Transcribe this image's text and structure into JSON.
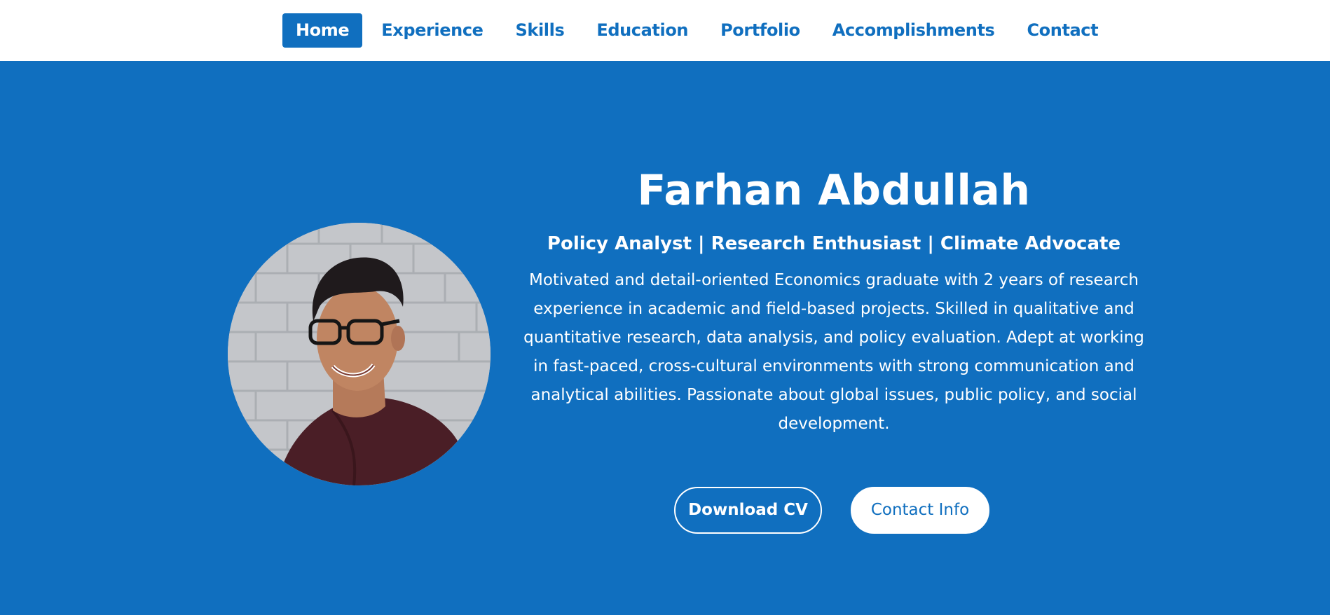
{
  "nav": {
    "items": [
      {
        "label": "Home",
        "active": true
      },
      {
        "label": "Experience",
        "active": false
      },
      {
        "label": "Skills",
        "active": false
      },
      {
        "label": "Education",
        "active": false
      },
      {
        "label": "Portfolio",
        "active": false
      },
      {
        "label": "Accomplishments",
        "active": false
      },
      {
        "label": "Contact",
        "active": false
      }
    ]
  },
  "hero": {
    "name": "Farhan Abdullah",
    "tagline": "Policy Analyst | Research Enthusiast | Climate Advocate",
    "bio": "Motivated and detail-oriented Economics graduate with 2 years of research experience in academic and field-based projects. Skilled in qualitative and quantitative research, data analysis, and policy evaluation. Adept at working in fast-paced, cross-cultural environments with strong communication and analytical abilities. Passionate about global issues, public policy, and social development.",
    "buttons": {
      "download_cv": "Download CV",
      "contact_info": "Contact Info"
    }
  },
  "colors": {
    "primary": "#106fbf",
    "white": "#ffffff"
  }
}
